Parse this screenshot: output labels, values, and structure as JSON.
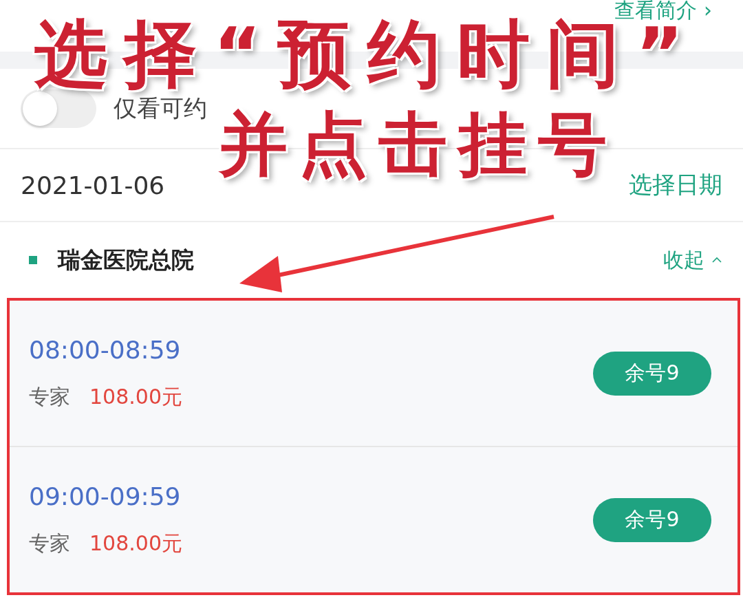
{
  "header_link": {
    "label": "查看简介",
    "icon": "›"
  },
  "toggle": {
    "label": "仅看可约",
    "on": false
  },
  "date_row": {
    "date": "2021-01-06",
    "action": "选择日期"
  },
  "hospital": {
    "name": "瑞金医院总院",
    "color": "#1fa381",
    "action": "收起",
    "expanded": true
  },
  "slots": [
    {
      "time": "08:00-08:59",
      "type": "专家",
      "price": "108.00元",
      "button": "余号9"
    },
    {
      "time": "09:00-09:59",
      "type": "专家",
      "price": "108.00元",
      "button": "余号9"
    }
  ],
  "annotation": {
    "lines": [
      "选择“预约时间”",
      "并点击挂号"
    ]
  }
}
